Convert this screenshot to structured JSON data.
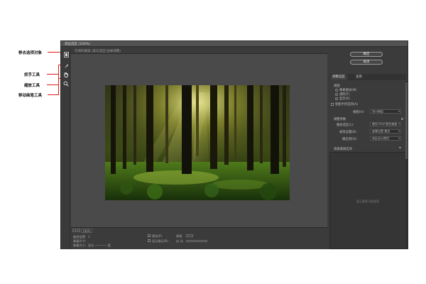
{
  "window": {
    "title": "调出选区 (100%)"
  },
  "canvas": {
    "tab_label": "可调的蒙版 (柔化选区/边缘调整)"
  },
  "toolbar": {
    "tools": [
      {
        "name": "mask-edit-icon",
        "glyph": "⧉"
      },
      {
        "name": "brush-icon",
        "glyph": "✎"
      },
      {
        "name": "hand-icon",
        "glyph": "✋"
      },
      {
        "name": "zoom-icon",
        "glyph": "⌕"
      }
    ]
  },
  "callouts": [
    {
      "label": "移去选项对象"
    },
    {
      "label": "抓手工具"
    },
    {
      "label": "缩放工具"
    },
    {
      "label": "移动画笔工具"
    }
  ],
  "bottom": {
    "zoom": "100%",
    "line1_label": "曲线设置:",
    "line1_value": "1",
    "line2_label": "像素尺寸:",
    "line3_label": "像素大小:",
    "line3_value": "显示 ———— 度",
    "check1_label": "预览(P)",
    "check1_extra": "原图",
    "check2_label": "显示指示(R)",
    "check2_extra": "自 动"
  },
  "panel": {
    "ok_label": "确定",
    "cancel_label": "取消",
    "tabs": [
      "调整选区",
      "查看"
    ],
    "section1": "视图",
    "radio1": "像素模式(M)",
    "radio2": "透明(T)",
    "radio3": "显示(S)",
    "check_mask": "智能半径选项(A)",
    "row_view_label": "视图(V):",
    "row_view_value": "显示图层",
    "row_params_label": "调整参数",
    "row_a_label": "图层选区(L):",
    "row_a_value": "使用 RGB 颜色通道",
    "row_b_label": "画笔设置(B):",
    "row_b_value": "画笔设置 使用",
    "row_c_label": "输出到(O):",
    "row_c_value": "选区显示使用",
    "advanced_label": "高级微调选项",
    "advanced_note": "显示更多可用选项"
  },
  "colors": {
    "dialog_bg": "#3c3c3c",
    "callout_line": "#e11b1b"
  }
}
